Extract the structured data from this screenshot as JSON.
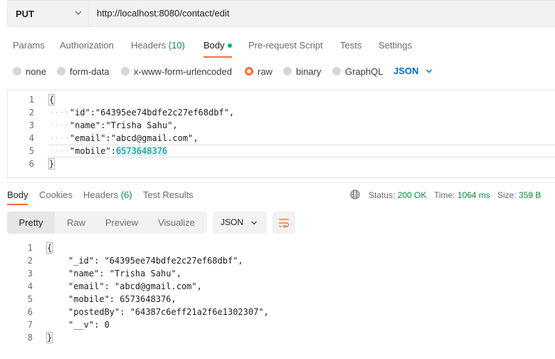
{
  "request": {
    "method": "PUT",
    "url": "http://localhost:8080/contact/edit"
  },
  "request_tabs": [
    {
      "label": "Params"
    },
    {
      "label": "Authorization"
    },
    {
      "label": "Headers",
      "count": "(10)"
    },
    {
      "label": "Body"
    },
    {
      "label": "Pre-request Script"
    },
    {
      "label": "Tests"
    },
    {
      "label": "Settings"
    }
  ],
  "body_types": [
    "none",
    "form-data",
    "x-www-form-urlencoded",
    "raw",
    "binary",
    "GraphQL"
  ],
  "body_format": "JSON",
  "request_body": {
    "line_numbers": [
      "1",
      "2",
      "3",
      "4",
      "5",
      "6"
    ],
    "open_brace": "{",
    "close_brace": "}",
    "fields": [
      {
        "key": "\"id\"",
        "value": "\"64395ee74bdfe2c27ef68dbf\"",
        "comma": ","
      },
      {
        "key": "\"name\"",
        "value": "\"Trisha Sahu\"",
        "comma": ","
      },
      {
        "key": "\"email\"",
        "value": "\"abcd@gmail.com\"",
        "comma": ","
      },
      {
        "key": "\"mobile\"",
        "value": "6573648376",
        "comma": ""
      }
    ]
  },
  "response_tabs": [
    {
      "label": "Body"
    },
    {
      "label": "Cookies"
    },
    {
      "label": "Headers",
      "count": "(6)"
    },
    {
      "label": "Test Results"
    }
  ],
  "response_status": {
    "status_label": "Status:",
    "status_value": "200 OK",
    "time_label": "Time:",
    "time_value": "1064 ms",
    "size_label": "Size:",
    "size_value": "359 B"
  },
  "view_modes": [
    "Pretty",
    "Raw",
    "Preview",
    "Visualize"
  ],
  "response_format": "JSON",
  "response_body": {
    "line_numbers": [
      "1",
      "2",
      "3",
      "4",
      "5",
      "6",
      "7",
      "8"
    ],
    "open_brace": "{",
    "close_brace": "}",
    "fields": [
      {
        "key": "\"_id\"",
        "sep": ": ",
        "value": "\"64395ee74bdfe2c27ef68dbf\"",
        "comma": ","
      },
      {
        "key": "\"name\"",
        "sep": ": ",
        "value": "\"Trisha Sahu\"",
        "comma": ","
      },
      {
        "key": "\"email\"",
        "sep": ": ",
        "value": "\"abcd@gmail.com\"",
        "comma": ","
      },
      {
        "key": "\"mobile\"",
        "sep": ": ",
        "value": "6573648376",
        "comma": ","
      },
      {
        "key": "\"postedBy\"",
        "sep": ": ",
        "value": "\"64387c6eff21a2f6e1302307\"",
        "comma": ","
      },
      {
        "key": "\"__v\"",
        "sep": ": ",
        "value": "0",
        "comma": ""
      }
    ]
  },
  "colors": {
    "accent": "#ff6c37",
    "active_dot": "#0cbb52",
    "link_blue": "#0265d2",
    "status_green": "#0a8f3e"
  }
}
